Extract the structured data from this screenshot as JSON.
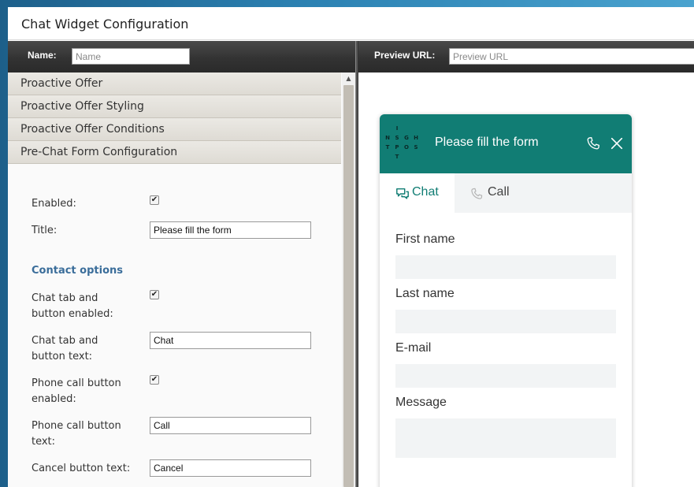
{
  "window": {
    "title": "Chat Widget Configuration"
  },
  "toolbar": {
    "name_label": "Name:",
    "name_placeholder": "Name",
    "preview_label": "Preview URL:",
    "preview_placeholder": "Preview URL"
  },
  "accordion": {
    "sections": [
      {
        "label": "Proactive Offer"
      },
      {
        "label": "Proactive Offer Styling"
      },
      {
        "label": "Proactive Offer Conditions"
      },
      {
        "label": "Pre-Chat Form Configuration"
      }
    ]
  },
  "form": {
    "enabled_label": "Enabled:",
    "enabled_checked": "✔",
    "title_label": "Title:",
    "title_value": "Please fill the form",
    "contact_options_heading": "Contact options",
    "chat_tab_enabled_label": "Chat tab and button enabled:",
    "chat_tab_enabled_checked": "✔",
    "chat_tab_text_label": "Chat tab and button text:",
    "chat_tab_text_value": "Chat",
    "phone_enabled_label": "Phone call button enabled:",
    "phone_enabled_checked": "✔",
    "phone_text_label": "Phone call button text:",
    "phone_text_value": "Call",
    "cancel_text_label": "Cancel button text:",
    "cancel_text_value": "Cancel"
  },
  "widget": {
    "brand_color": "#117d74",
    "title": "Please fill the form",
    "logo_letters": [
      "",
      "I",
      "",
      "",
      "N",
      "S",
      "G",
      "H",
      "T",
      "P",
      "O",
      "S",
      "",
      "T",
      "",
      ""
    ],
    "tabs": [
      {
        "label": "Chat",
        "icon": "chat-bubbles-icon",
        "active": true
      },
      {
        "label": "Call",
        "icon": "phone-icon",
        "active": false
      }
    ],
    "fields": [
      {
        "label": "First name"
      },
      {
        "label": "Last name"
      },
      {
        "label": "E-mail"
      },
      {
        "label": "Message"
      }
    ]
  }
}
